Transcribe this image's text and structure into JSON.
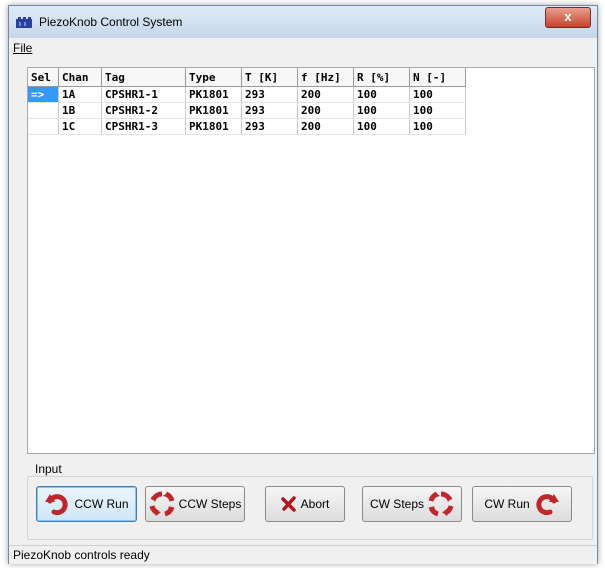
{
  "window": {
    "title": "PiezoKnob Control System",
    "close_label": "x"
  },
  "menu": {
    "file": "File"
  },
  "table": {
    "columns": [
      "Sel",
      "Chan",
      "Tag",
      "Type",
      "T [K]",
      "f [Hz]",
      "R [%]",
      "N [-]"
    ],
    "rows": [
      {
        "sel": "=>",
        "chan": "1A",
        "tag": "CPSHR1-1",
        "type": "PK1801",
        "t": "293",
        "f": "200",
        "r": "100",
        "n": "100"
      },
      {
        "sel": "",
        "chan": "1B",
        "tag": "CPSHR1-2",
        "type": "PK1801",
        "t": "293",
        "f": "200",
        "r": "100",
        "n": "100"
      },
      {
        "sel": "",
        "chan": "1C",
        "tag": "CPSHR1-3",
        "type": "PK1801",
        "t": "293",
        "f": "200",
        "r": "100",
        "n": "100"
      }
    ]
  },
  "input_group": {
    "label": "Input",
    "buttons": {
      "ccw_run": "CCW Run",
      "ccw_steps": "CCW Steps",
      "abort": "Abort",
      "cw_steps": "CW Steps",
      "cw_run": "CW Run"
    }
  },
  "status": {
    "text": "PiezoKnob controls ready"
  },
  "colors": {
    "selection": "#3399ff",
    "icon_red": "#c0272d",
    "abort_red": "#b3161d"
  }
}
